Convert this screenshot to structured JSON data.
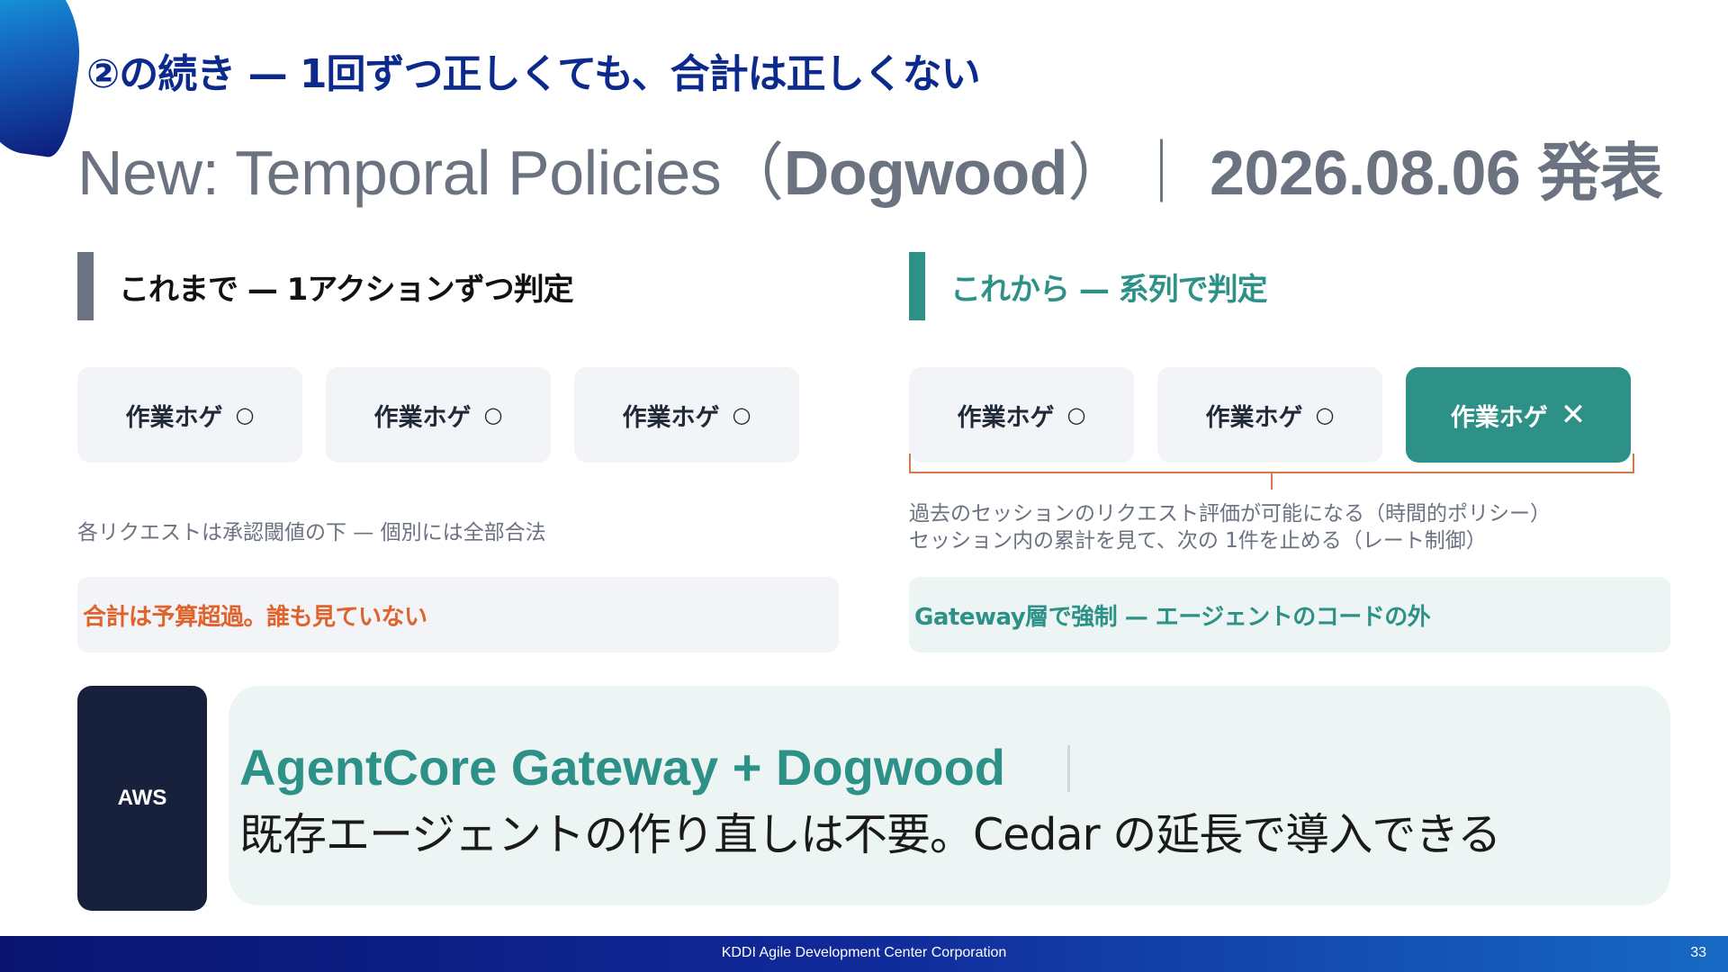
{
  "slide": {
    "title": "②の続き — 1回ずつ正しくても、合計は正しくない",
    "subtitle_prefix": "New: Temporal Policies（",
    "subtitle_bold": "Dogwood",
    "subtitle_mid": "）｜ ",
    "subtitle_date": "2026.08.06 発表"
  },
  "left": {
    "heading": "これまで — 1アクションずつ判定",
    "chips": [
      {
        "label": "作業ホゲ",
        "mark": "○"
      },
      {
        "label": "作業ホゲ",
        "mark": "○"
      },
      {
        "label": "作業ホゲ",
        "mark": "○"
      }
    ],
    "note": "各リクエストは承認閾値の下 — 個別には全部合法",
    "callout": "合計は予算超過。誰も見ていない"
  },
  "right": {
    "heading": "これから — 系列で判定",
    "chips": [
      {
        "label": "作業ホゲ",
        "mark": "○"
      },
      {
        "label": "作業ホゲ",
        "mark": "○"
      },
      {
        "label": "作業ホゲ",
        "mark": "✕"
      }
    ],
    "note_lines": [
      "過去のセッションのリクエスト評価が可能になる（時間的ポリシー）",
      "セッション内の累計を見て、次の 1件を止める（レート制御）"
    ],
    "callout": "Gateway層で強制 — エージェントのコードの外"
  },
  "takeaway": {
    "badge": "AWS",
    "title": "AgentCore Gateway + Dogwood",
    "body": "既存エージェントの作り直しは不要。Cedar の延長で導入できる"
  },
  "footer": {
    "company": "KDDI Agile Development Center Corporation",
    "page": "33"
  },
  "colors": {
    "title_blue": "#0b2a8c",
    "teal": "#2e9188",
    "orange": "#e0632c",
    "gray": "#6b7280",
    "navy_tile": "#17213b"
  }
}
